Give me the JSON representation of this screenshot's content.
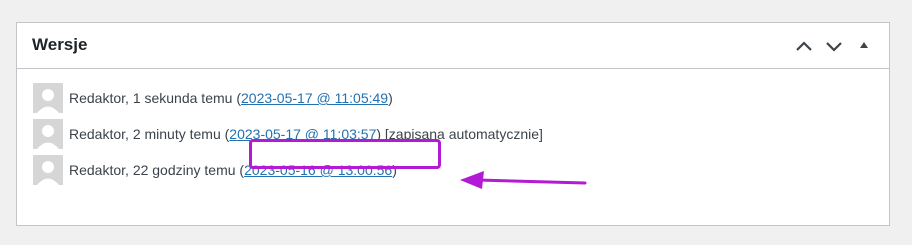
{
  "metabox": {
    "title": "Wersje",
    "controls": [
      {
        "name": "move-up-icon"
      },
      {
        "name": "move-down-icon"
      },
      {
        "name": "toggle-panel-icon"
      }
    ]
  },
  "revisions": [
    {
      "author": "Redaktor",
      "before_link": "Redaktor, 1 sekunda temu (",
      "link": "2023-05-17 @ 11:05:49",
      "after_link": ")"
    },
    {
      "author": "Redaktor",
      "before_link": "Redaktor, 2 minuty temu (",
      "link": "2023-05-17 @ 11:03:57",
      "after_link": ") [zapisana automatycznie]"
    },
    {
      "author": "Redaktor",
      "before_link": "Redaktor, 22 godziny temu (",
      "link": "2023-05-16 @ 13:00:56",
      "after_link": ")"
    }
  ],
  "annotation": {
    "highlighted_revision": "2023-05-16 @ 13:00:56",
    "color": "#b21ad6"
  }
}
